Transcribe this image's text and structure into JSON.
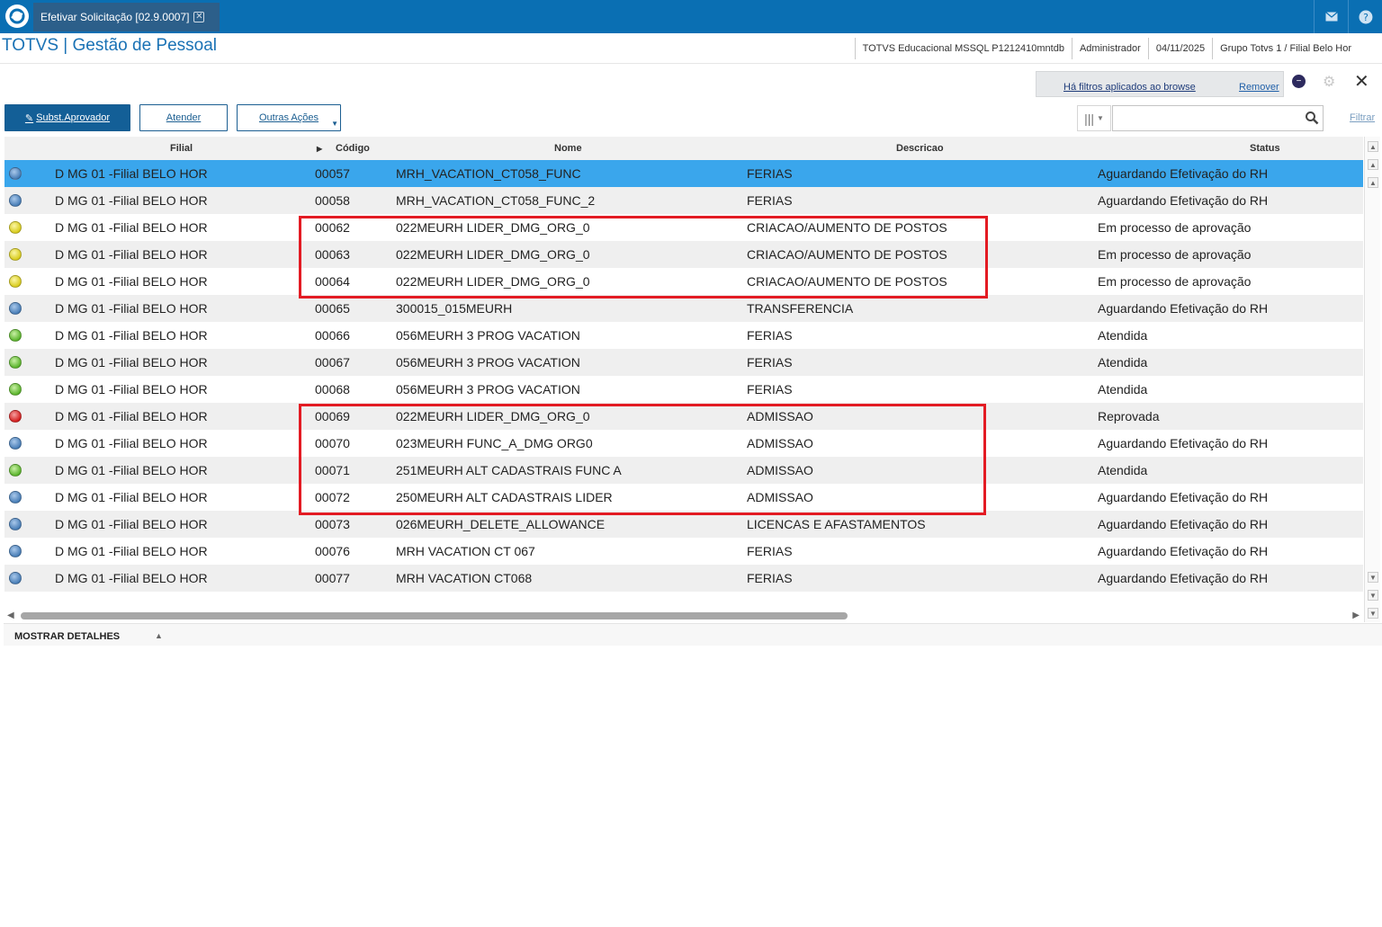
{
  "window": {
    "tab_title": "Efetivar Solicitação [02.9.0007]",
    "tab_close": "✕"
  },
  "header": {
    "app_title": "TOTVS | Gestão de Pessoal",
    "environment": "TOTVS Educacional MSSQL P1212410mntdb",
    "user": "Administrador",
    "date": "04/11/2025",
    "branch": "Grupo Totvs 1 / Filial Belo Hor"
  },
  "filter_notice": {
    "message": "Há filtros aplicados ao browse",
    "remove_label": "Remover"
  },
  "toolbar": {
    "subst_label": "Subst.Aprovador",
    "atender_label": "Atender",
    "outras_label": "Outras Ações",
    "filtrar_label": "Filtrar",
    "search_placeholder": ""
  },
  "columns": {
    "filial": "Filial",
    "codigo": "Código",
    "nome": "Nome",
    "descricao": "Descricao",
    "status": "Status"
  },
  "rows": [
    {
      "status_color": "blue",
      "filial": "D MG 01 -Filial BELO HOR",
      "codigo": "00057",
      "nome": "MRH_VACATION_CT058_FUNC",
      "descricao": "FERIAS",
      "status": "Aguardando Efetivação do RH",
      "selected": true
    },
    {
      "status_color": "blue",
      "filial": "D MG 01 -Filial BELO HOR",
      "codigo": "00058",
      "nome": "MRH_VACATION_CT058_FUNC_2",
      "descricao": "FERIAS",
      "status": "Aguardando Efetivação do RH"
    },
    {
      "status_color": "yellow",
      "filial": "D MG 01 -Filial BELO HOR",
      "codigo": "00062",
      "nome": "022MEURH LIDER_DMG_ORG_0",
      "descricao": "CRIACAO/AUMENTO DE POSTOS",
      "status": "Em processo de aprovação"
    },
    {
      "status_color": "yellow",
      "filial": "D MG 01 -Filial BELO HOR",
      "codigo": "00063",
      "nome": "022MEURH LIDER_DMG_ORG_0",
      "descricao": "CRIACAO/AUMENTO DE POSTOS",
      "status": "Em processo de aprovação"
    },
    {
      "status_color": "yellow",
      "filial": "D MG 01 -Filial BELO HOR",
      "codigo": "00064",
      "nome": "022MEURH LIDER_DMG_ORG_0",
      "descricao": "CRIACAO/AUMENTO DE POSTOS",
      "status": "Em processo de aprovação"
    },
    {
      "status_color": "blue",
      "filial": "D MG 01 -Filial BELO HOR",
      "codigo": "00065",
      "nome": "300015_015MEURH",
      "descricao": "TRANSFERENCIA",
      "status": "Aguardando Efetivação do RH"
    },
    {
      "status_color": "green",
      "filial": "D MG 01 -Filial BELO HOR",
      "codigo": "00066",
      "nome": "056MEURH 3 PROG VACATION",
      "descricao": "FERIAS",
      "status": "Atendida"
    },
    {
      "status_color": "green",
      "filial": "D MG 01 -Filial BELO HOR",
      "codigo": "00067",
      "nome": "056MEURH 3 PROG VACATION",
      "descricao": "FERIAS",
      "status": "Atendida"
    },
    {
      "status_color": "green",
      "filial": "D MG 01 -Filial BELO HOR",
      "codigo": "00068",
      "nome": "056MEURH 3 PROG VACATION",
      "descricao": "FERIAS",
      "status": "Atendida"
    },
    {
      "status_color": "red",
      "filial": "D MG 01 -Filial BELO HOR",
      "codigo": "00069",
      "nome": "022MEURH LIDER_DMG_ORG_0",
      "descricao": "ADMISSAO",
      "status": "Reprovada"
    },
    {
      "status_color": "blue",
      "filial": "D MG 01 -Filial BELO HOR",
      "codigo": "00070",
      "nome": "023MEURH FUNC_A_DMG ORG0",
      "descricao": "ADMISSAO",
      "status": "Aguardando Efetivação do RH"
    },
    {
      "status_color": "green",
      "filial": "D MG 01 -Filial BELO HOR",
      "codigo": "00071",
      "nome": "251MEURH ALT CADASTRAIS FUNC A",
      "descricao": "ADMISSAO",
      "status": "Atendida"
    },
    {
      "status_color": "blue",
      "filial": "D MG 01 -Filial BELO HOR",
      "codigo": "00072",
      "nome": "250MEURH ALT CADASTRAIS LIDER",
      "descricao": "ADMISSAO",
      "status": "Aguardando Efetivação do RH"
    },
    {
      "status_color": "blue",
      "filial": "D MG 01 -Filial BELO HOR",
      "codigo": "00073",
      "nome": "026MEURH_DELETE_ALLOWANCE",
      "descricao": "LICENCAS E AFASTAMENTOS",
      "status": "Aguardando Efetivação do RH"
    },
    {
      "status_color": "blue",
      "filial": "D MG 01 -Filial BELO HOR",
      "codigo": "00076",
      "nome": "MRH VACATION CT 067",
      "descricao": "FERIAS",
      "status": "Aguardando Efetivação do RH"
    },
    {
      "status_color": "blue",
      "filial": "D MG 01 -Filial BELO HOR",
      "codigo": "00077",
      "nome": "MRH VACATION CT068",
      "descricao": "FERIAS",
      "status": "Aguardando Efetivação do RH"
    }
  ],
  "footer": {
    "details_label": "MOSTRAR DETALHES"
  },
  "colors": {
    "topbar": "#0a6fb3",
    "selected_row": "#3aa6ec",
    "highlight_box": "#e31b23",
    "primary_button": "#135f97"
  },
  "icons": [
    "totvs-logo-icon",
    "mail-icon",
    "help-icon",
    "pencil-icon",
    "columns-icon",
    "search-icon",
    "gear-icon",
    "close-icon",
    "filter-badge-icon"
  ]
}
